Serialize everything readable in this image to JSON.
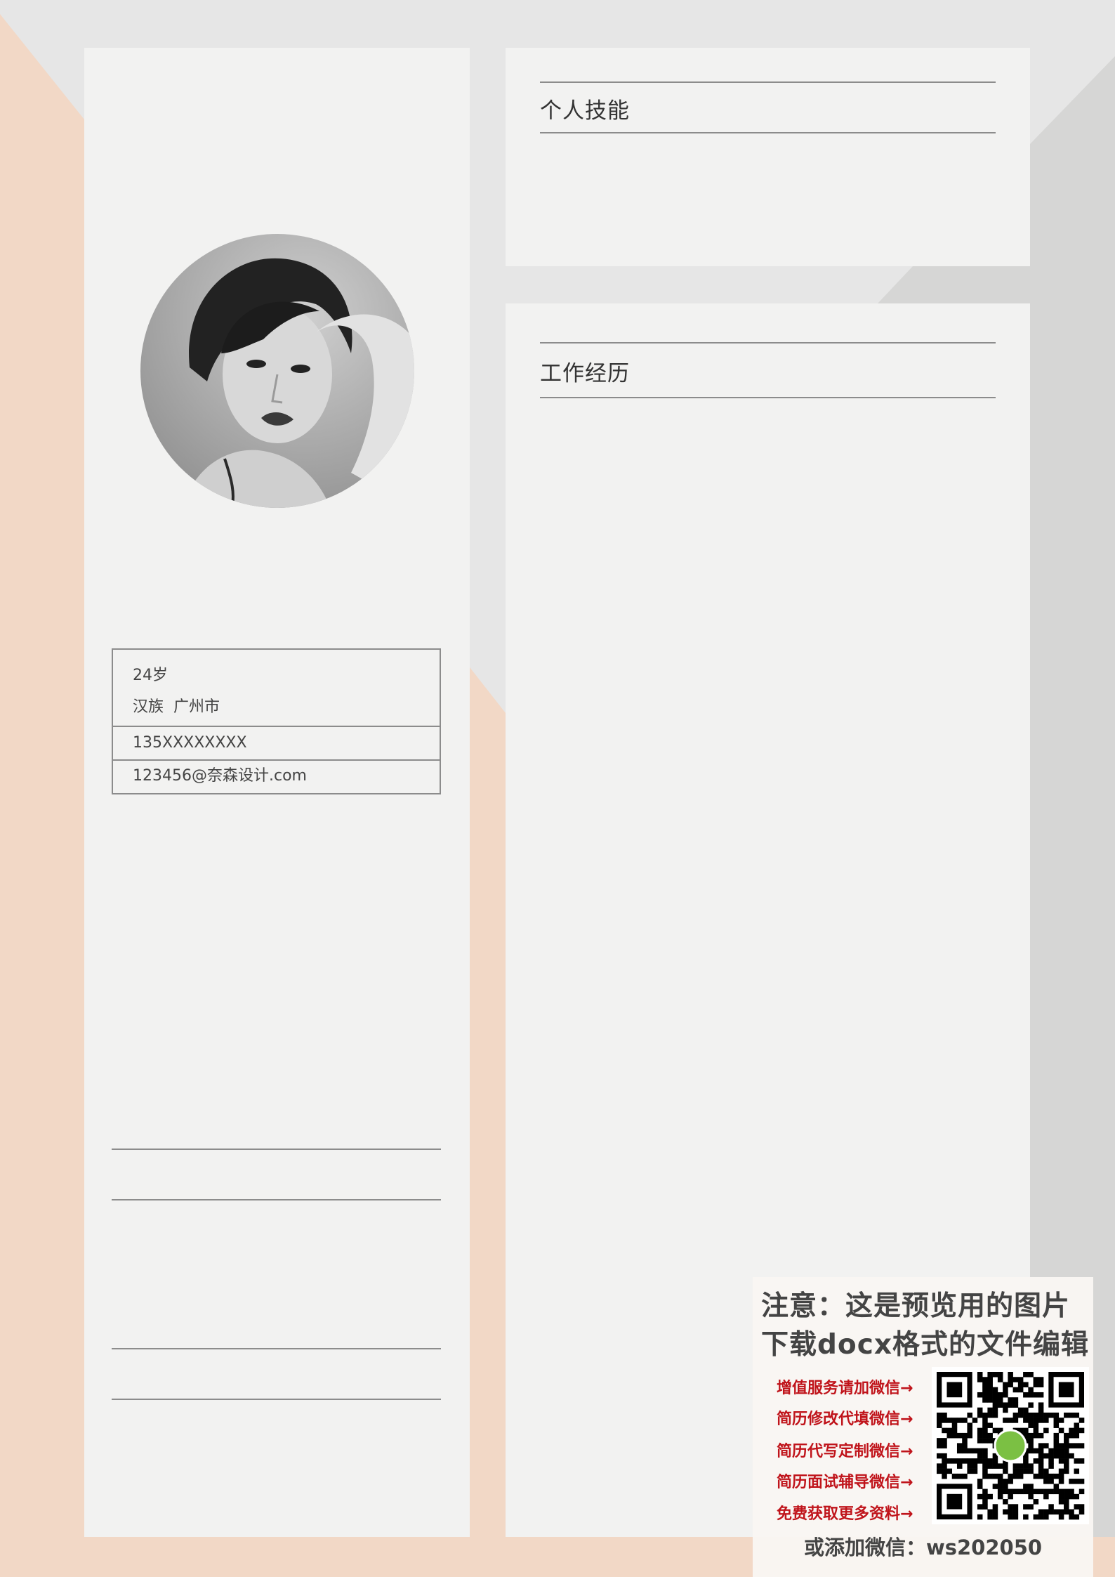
{
  "page": {
    "background": "#e6e6e6",
    "panel_color": "#f2f2f1",
    "accent_peach": "#f2d8c6"
  },
  "sections": {
    "skills_title": "个人技能",
    "work_title": "工作经历"
  },
  "profile": {
    "photo_icon": "portrait-photo",
    "age": "24岁",
    "ethnicity": "汉族",
    "city": "广州市",
    "phone": "135XXXXXXXX",
    "email": "123456@奈森设计.com"
  },
  "notice": {
    "line1": "注意：这是预览用的图片",
    "line2": "下载docx格式的文件编辑",
    "services": [
      "增值服务请加微信→",
      "简历修改代填微信→",
      "简历代写定制微信→",
      "简历面试辅导微信→",
      "免费获取更多资料→"
    ],
    "qr_icon": "qr-code",
    "wechat_line": "或添加微信：ws202050",
    "accent": "#c0141b"
  }
}
